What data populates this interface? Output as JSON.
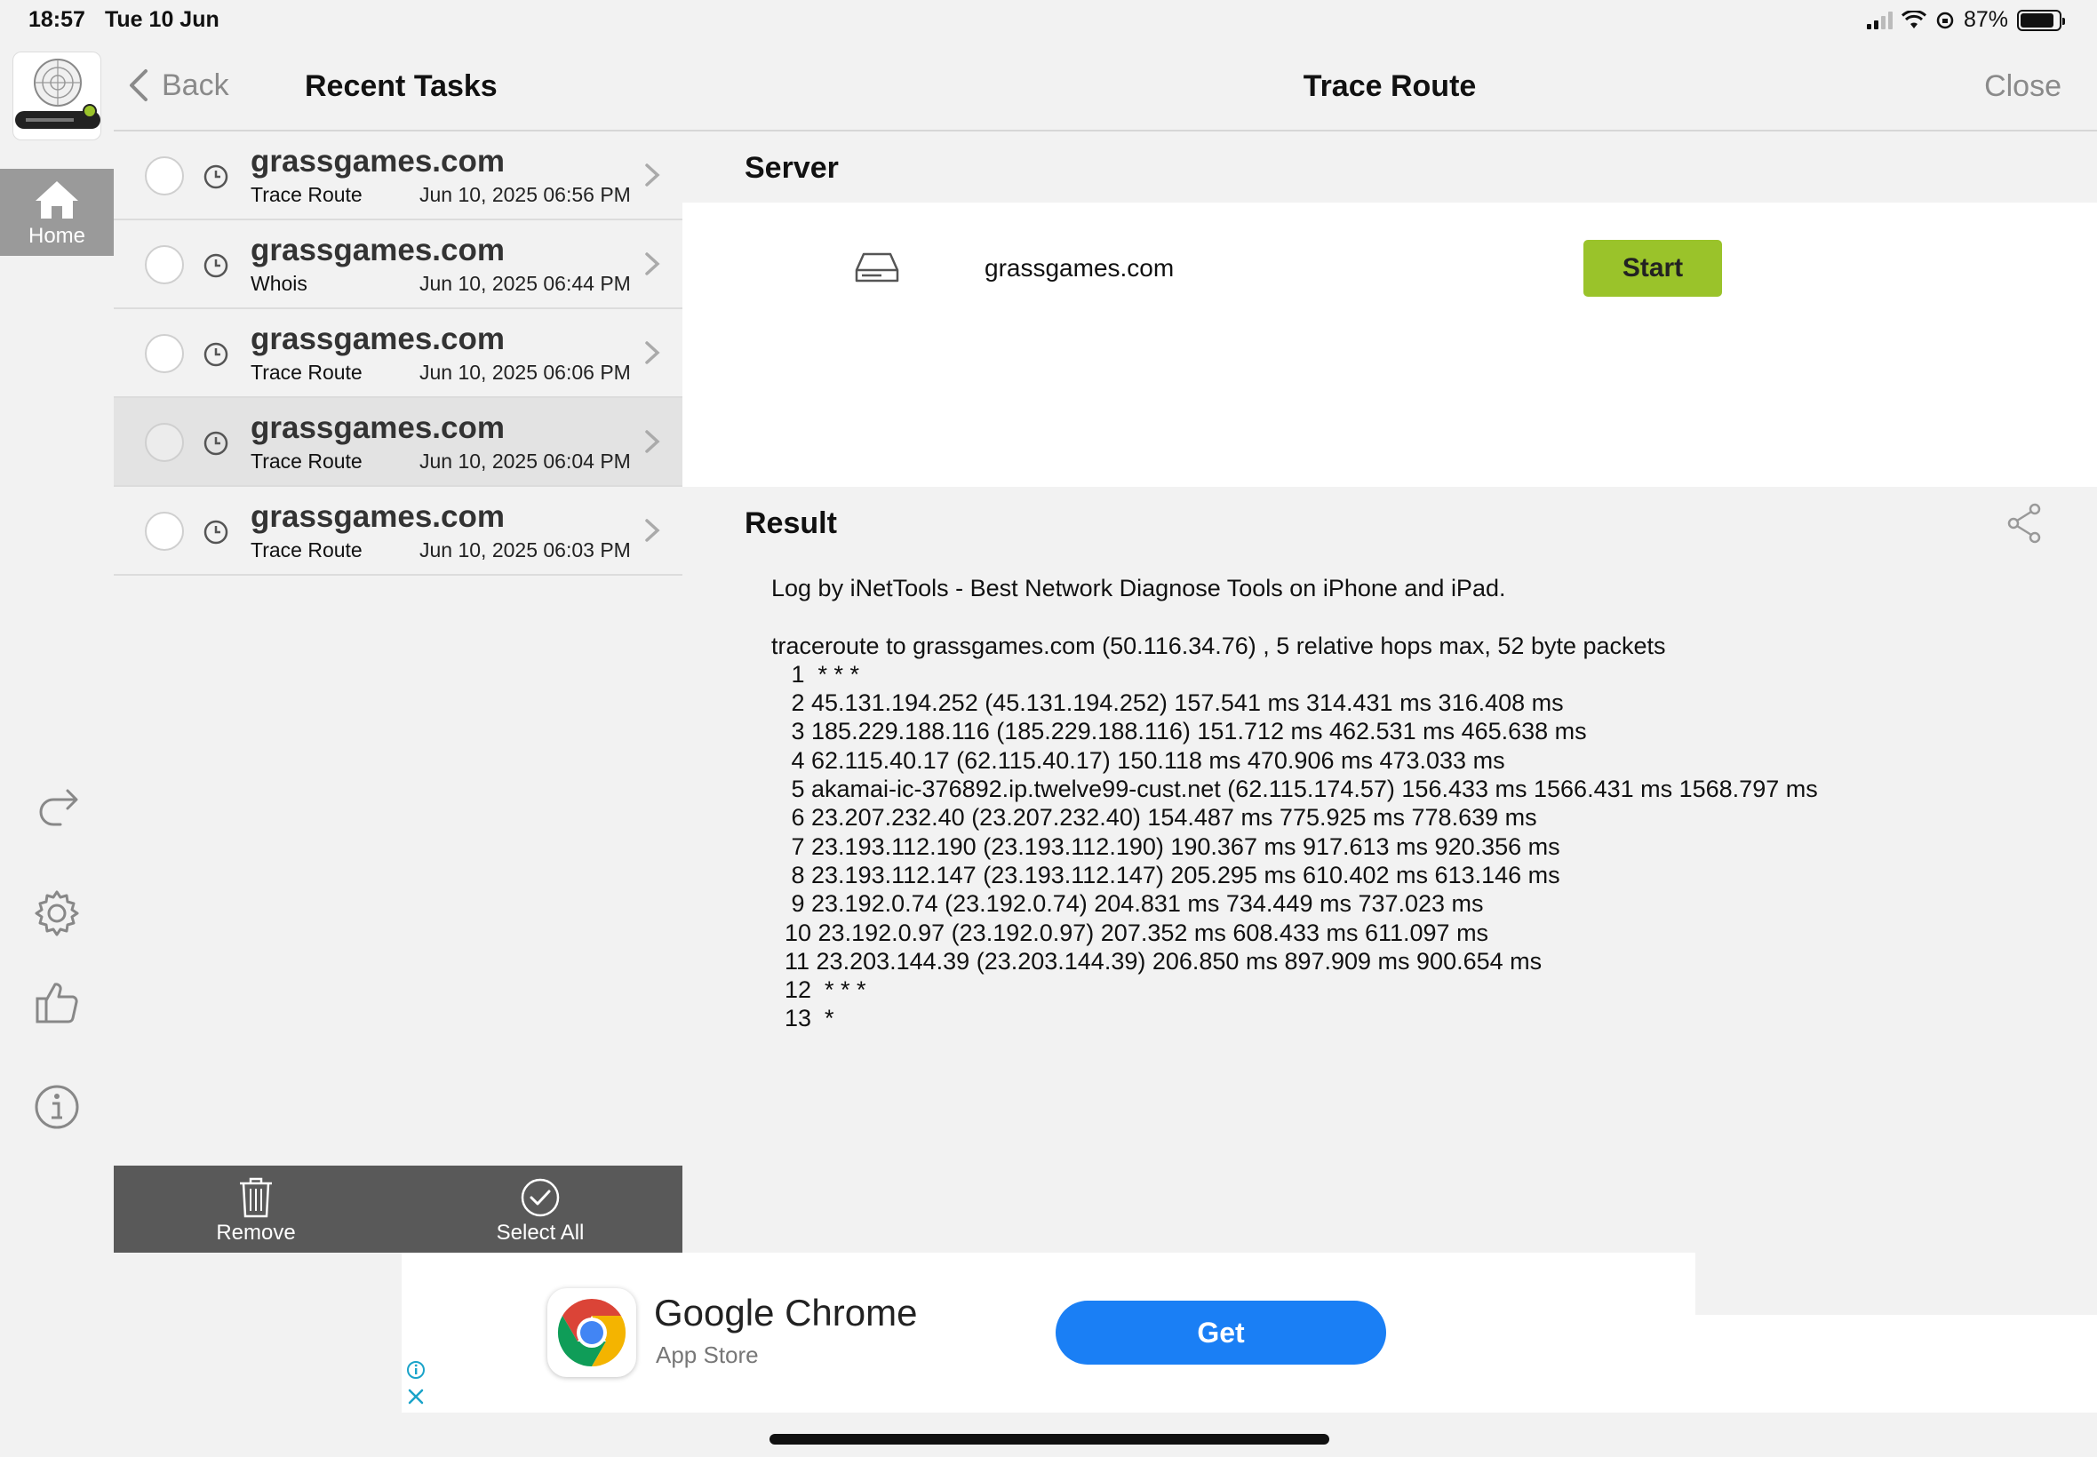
{
  "status_bar": {
    "time": "18:57",
    "date": "Tue 10 Jun",
    "battery": "87%",
    "battery_level": 0.87
  },
  "sidebar": {
    "home_label": "Home",
    "icons": [
      "redirect-icon",
      "gear-icon",
      "thumbs-up-icon",
      "info-icon"
    ]
  },
  "tasks_panel": {
    "back_label": "Back",
    "title": "Recent Tasks",
    "items": [
      {
        "host": "grassgames.com",
        "type": "Trace Route",
        "date": "Jun 10, 2025 06:56 PM"
      },
      {
        "host": "grassgames.com",
        "type": "Whois",
        "date": "Jun 10, 2025 06:44 PM"
      },
      {
        "host": "grassgames.com",
        "type": "Trace Route",
        "date": "Jun 10, 2025 06:06 PM"
      },
      {
        "host": "grassgames.com",
        "type": "Trace Route",
        "date": "Jun 10, 2025 06:04 PM"
      },
      {
        "host": "grassgames.com",
        "type": "Trace Route",
        "date": "Jun 10, 2025 06:03 PM"
      }
    ],
    "selected_index": 3,
    "toolbar": {
      "remove_label": "Remove",
      "select_all_label": "Select All"
    }
  },
  "detail": {
    "title": "Trace Route",
    "close_label": "Close",
    "server_section": "Server",
    "server_host": "grassgames.com",
    "start_label": "Start",
    "result_section": "Result",
    "log_lines": [
      "Log by iNetTools - Best Network Diagnose Tools on iPhone and iPad.",
      "",
      "traceroute to grassgames.com (50.116.34.76) , 5 relative hops max, 52 byte packets",
      "   1  * * *",
      "   2 45.131.194.252 (45.131.194.252) 157.541 ms 314.431 ms 316.408 ms",
      "   3 185.229.188.116 (185.229.188.116) 151.712 ms 462.531 ms 465.638 ms",
      "   4 62.115.40.17 (62.115.40.17) 150.118 ms 470.906 ms 473.033 ms",
      "   5 akamai-ic-376892.ip.twelve99-cust.net (62.115.174.57) 156.433 ms 1566.431 ms 1568.797 ms",
      "   6 23.207.232.40 (23.207.232.40) 154.487 ms 775.925 ms 778.639 ms",
      "   7 23.193.112.190 (23.193.112.190) 190.367 ms 917.613 ms 920.356 ms",
      "   8 23.193.112.147 (23.193.112.147) 205.295 ms 610.402 ms 613.146 ms",
      "   9 23.192.0.74 (23.192.0.74) 204.831 ms 734.449 ms 737.023 ms",
      "  10 23.192.0.97 (23.192.0.97) 207.352 ms 608.433 ms 611.097 ms",
      "  11 23.203.144.39 (23.203.144.39) 206.850 ms 897.909 ms 900.654 ms",
      "  12  * * *",
      "  13  *"
    ]
  },
  "ad": {
    "app_name": "Google Chrome",
    "store": "App Store",
    "cta": "Get",
    "cta_color": "#1a7ff5"
  },
  "colors": {
    "start_button": "#9ac32a",
    "toolbar": "#595959",
    "home_selected": "#9a9a9a"
  }
}
